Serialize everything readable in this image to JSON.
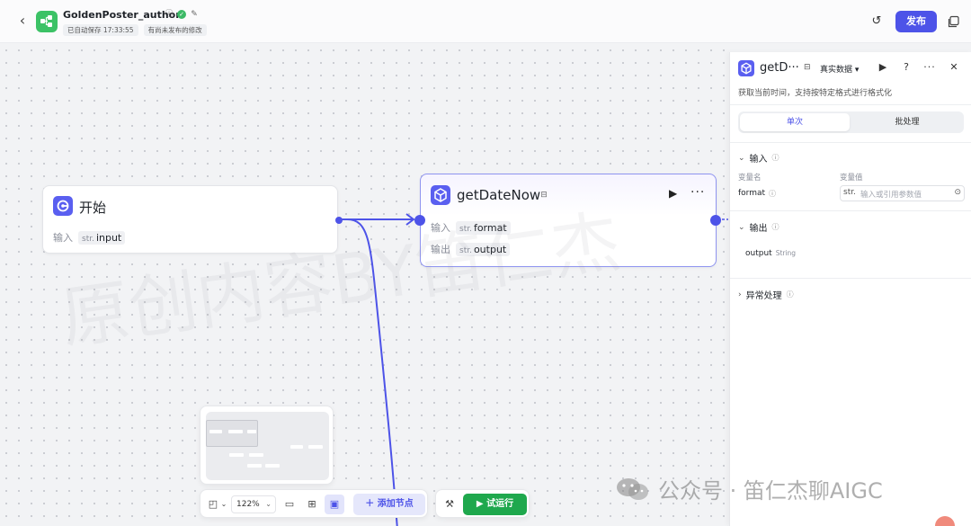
{
  "header": {
    "app_title": "GoldenPoster_author",
    "autosave": "已自动保存 17:33:55",
    "unpublished": "有尚未发布的修改",
    "publish_label": "发布"
  },
  "nodes": {
    "start": {
      "title": "开始",
      "input_label": "输入",
      "input_type": "str.",
      "input_name": "input"
    },
    "date": {
      "title": "getDateNow",
      "input_label": "输入",
      "input_type": "str.",
      "input_name": "format",
      "output_label": "输出",
      "output_type": "str.",
      "output_name": "output"
    }
  },
  "toolbar": {
    "zoom": "122%",
    "add_node_label": "添加节点",
    "test_run_label": "试运行"
  },
  "panel": {
    "title": "getD···",
    "data_mode": "真实数据 ▾",
    "description": "获取当前时间，支持按特定格式进行格式化",
    "tab_single": "单次",
    "tab_batch": "批处理",
    "input_section": "输入",
    "col_var_name": "变量名",
    "col_var_value": "变量值",
    "format_label": "format",
    "format_type": "str.",
    "format_placeholder": "输入或引用参数值",
    "output_section": "输出",
    "output_name": "output",
    "output_type": "String",
    "exception_section": "异常处理"
  },
  "watermark": {
    "text": "原创内容BY笛仁杰",
    "wechat": "公众号 · 笛仁杰聊AIGC"
  },
  "colors": {
    "accent": "#4d53e8",
    "run_green": "#1fa84d",
    "logo_green": "#3cc266"
  }
}
